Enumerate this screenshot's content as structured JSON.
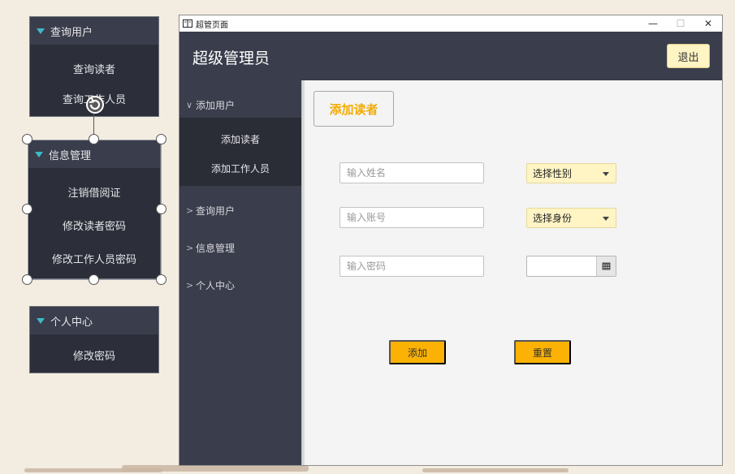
{
  "canvas": {
    "panel_query": {
      "header": "查询用户",
      "items": [
        "查询读者",
        "查询工作人员"
      ]
    },
    "panel_info": {
      "header": "信息管理",
      "items": [
        "注销借阅证",
        "修改读者密码",
        "修改工作人员密码"
      ]
    },
    "panel_personal": {
      "header": "个人中心",
      "items": [
        "修改密码"
      ]
    }
  },
  "window": {
    "title": "超管页面",
    "controls": {
      "minimize": "—",
      "maximize": "☐",
      "close": "✕"
    },
    "heading": "超级管理员",
    "logout_label": "退出"
  },
  "sidebar": {
    "groups": [
      {
        "label": "添加用户",
        "expanded": true,
        "items": [
          "添加读者",
          "添加工作人员"
        ]
      },
      {
        "label": "查询用户",
        "expanded": false
      },
      {
        "label": "信息管理",
        "expanded": false
      },
      {
        "label": "个人中心",
        "expanded": false
      }
    ],
    "chevron_expanded": "∨",
    "chevron_collapsed": ">"
  },
  "form": {
    "tab_label": "添加读者",
    "name_placeholder": "输入姓名",
    "account_placeholder": "输入账号",
    "password_placeholder": "输入密码",
    "gender_label": "选择性别",
    "role_label": "选择身份",
    "date_value": "",
    "add_label": "添加",
    "reset_label": "重置"
  },
  "colors": {
    "accent": "#fbb204",
    "accent_text": "#f2ac05",
    "dark_panel": "#3a3d4b",
    "combo_bg": "#fff4c4"
  },
  "icons": {
    "window_icon": "book-icon",
    "expand_marker": "triangle-down-icon",
    "rotate_handle": "rotate-icon",
    "calendar": "calendar-icon"
  }
}
